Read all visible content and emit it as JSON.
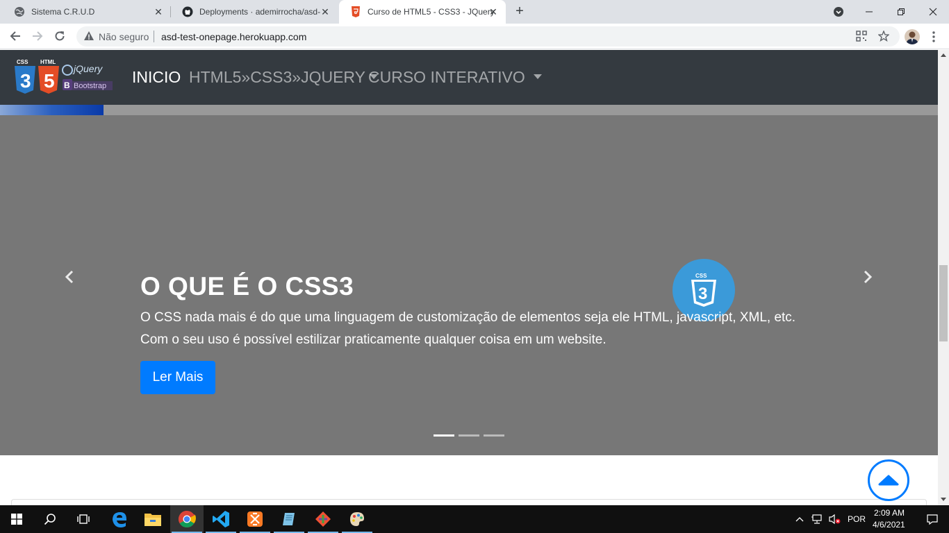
{
  "browser": {
    "tabs": [
      {
        "title": "Sistema C.R.U.D",
        "icon": "globe-icon"
      },
      {
        "title": "Deployments · ademirrocha/asd-",
        "icon": "github-icon"
      },
      {
        "title": "Curso de HTML5 - CSS3 - JQuery",
        "icon": "html5-icon",
        "active": true
      }
    ],
    "security_label": "Não seguro",
    "url": "asd-test-onepage.herokuapp.com"
  },
  "navbar": {
    "links": [
      "INICIO",
      "HTML5»CSS3»JQUERY",
      "CURSO INTERATIVO"
    ],
    "active_index": 0,
    "logo": {
      "css": "CSS",
      "html": "HTML",
      "jquery": "jQuery",
      "bootstrap": "Bootstrap",
      "b": "B"
    }
  },
  "scroll_progress": 0.11,
  "carousel": {
    "title": "O QUE É O CSS3",
    "text": "O CSS nada mais é do que uma linguagem de customização de elementos seja ele HTML, javascript, XML, etc. Com o seu uso é possível estilizar praticamente qualquer coisa em um website.",
    "button": "Ler Mais",
    "badge": {
      "label": "CSS",
      "number": "3"
    },
    "slide_count": 3,
    "active_slide": 0
  },
  "taskbar": {
    "apps": [
      "windows-start-icon",
      "search-icon",
      "task-view-icon",
      "edge-icon",
      "file-explorer-icon",
      "chrome-icon",
      "vscode-icon",
      "xampp-icon",
      "notepad-icon",
      "git-icon",
      "paint-icon"
    ],
    "language": "POR",
    "time": "2:09 AM",
    "date": "4/6/2021"
  },
  "colors": {
    "navbar": "#343a40",
    "carousel": "#777777",
    "primary": "#007bff",
    "css3": "#3b9ad9"
  }
}
